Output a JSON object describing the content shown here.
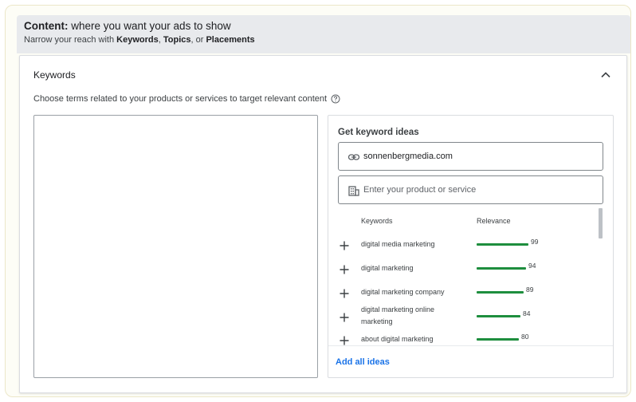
{
  "header": {
    "title_bold": "Content:",
    "title_rest": " where you want your ads to show",
    "subtitle_prefix": "Narrow your reach with ",
    "subtitle_keywords": "Keywords",
    "subtitle_sep1": ", ",
    "subtitle_topics": "Topics",
    "subtitle_sep2": ", or ",
    "subtitle_placements": "Placements"
  },
  "keywords_section": {
    "title": "Keywords",
    "description": "Choose terms related to your products or services to target relevant content",
    "collapse_icon": "chevron-up-icon",
    "help_icon": "help-circle-icon"
  },
  "ideas": {
    "title": "Get keyword ideas",
    "url_value": "sonnenbergmedia.com",
    "url_icon": "link-icon",
    "product_placeholder": "Enter your product or service",
    "product_icon": "building-icon",
    "col_keywords": "Keywords",
    "col_relevance": "Relevance",
    "accent_color": "#1e8e3e",
    "rows": [
      {
        "keyword": "digital media marketing",
        "relevance": 99
      },
      {
        "keyword": "digital marketing",
        "relevance": 94
      },
      {
        "keyword": "digital marketing company",
        "relevance": 89
      },
      {
        "keyword": "digital marketing online marketing",
        "relevance": 84
      },
      {
        "keyword": "about digital marketing",
        "relevance": 80
      }
    ],
    "add_all_label": "Add all ideas",
    "link_color": "#1a73e8"
  }
}
